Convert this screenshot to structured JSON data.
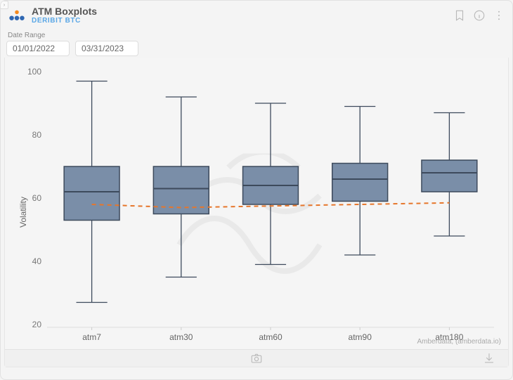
{
  "header": {
    "title": "ATM Boxplots",
    "subtitle": "DERIBIT BTC"
  },
  "controls": {
    "date_range_label": "Date Range",
    "date_from": "01/01/2022",
    "date_to": "03/31/2023"
  },
  "chart": {
    "ylabel": "Volatility",
    "attribution": "Amberdata, (amberdata.io)"
  },
  "chart_data": {
    "type": "boxplot",
    "ylabel": "Volatility",
    "ylim": [
      20,
      100
    ],
    "yticks": [
      20,
      40,
      60,
      80,
      100
    ],
    "categories": [
      "atm7",
      "atm30",
      "atm60",
      "atm90",
      "atm180"
    ],
    "series": [
      {
        "name": "atm7",
        "min": 27,
        "q1": 53,
        "median": 62,
        "q3": 70,
        "max": 97
      },
      {
        "name": "atm30",
        "min": 35,
        "q1": 55,
        "median": 63,
        "q3": 70,
        "max": 92
      },
      {
        "name": "atm60",
        "min": 39,
        "q1": 58,
        "median": 64,
        "q3": 70,
        "max": 90
      },
      {
        "name": "atm90",
        "min": 42,
        "q1": 59,
        "median": 66,
        "q3": 71,
        "max": 89
      },
      {
        "name": "atm180",
        "min": 48,
        "q1": 62,
        "median": 68,
        "q3": 72,
        "max": 87
      }
    ],
    "trend_line": {
      "style": "dashed",
      "color": "#e6762b",
      "values": [
        58,
        57,
        57.5,
        58,
        58.5
      ]
    },
    "box_fill": "#7a8ea8",
    "box_stroke": "#3d4a5c"
  }
}
